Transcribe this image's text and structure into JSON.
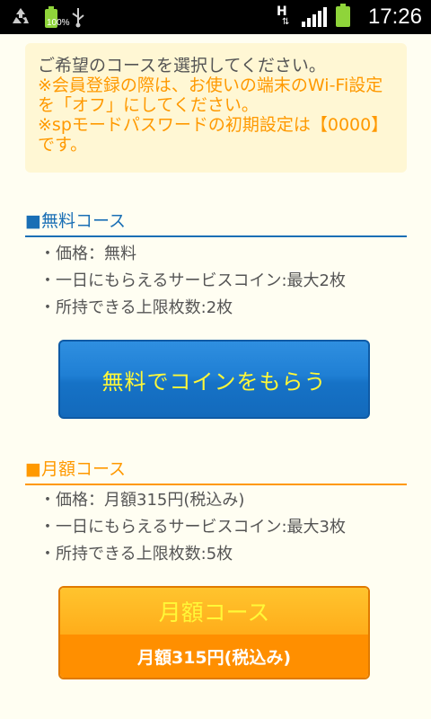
{
  "statusbar": {
    "time": "17:26",
    "battery_small_label": "100%",
    "network_label": "H",
    "icons": [
      "recycle-icon",
      "battery-icon",
      "usb-icon",
      "network-h-icon",
      "signal-icon",
      "battery-icon"
    ]
  },
  "notice": {
    "line1": "ご希望のコースを選択してください。",
    "line2": "※会員登録の際は、お使いの端末のWi-Fi設定",
    "line3": "を「オフ」にしてください。",
    "line4": "※spモードパスワードの初期設定は【0000】",
    "line5": "です。"
  },
  "free_course": {
    "title": "■無料コース",
    "items": [
      "・価格：無料",
      "・一日にもらえるサービスコイン:最大2枚",
      "・所持できる上限枚数:2枚"
    ],
    "button_label": "無料でコインをもらう"
  },
  "monthly_course": {
    "title": "■月額コース",
    "items": [
      "・価格：月額315円(税込み)",
      "・一日にもらえるサービスコイン:最大3枚",
      "・所持できる上限枚数:5枚"
    ],
    "button_title": "月額コース",
    "button_price": "月額315円(税込み)"
  },
  "colors": {
    "accent_blue": "#1a6fb5",
    "accent_orange": "#ff9900",
    "button_text_yellow": "#fff838"
  }
}
